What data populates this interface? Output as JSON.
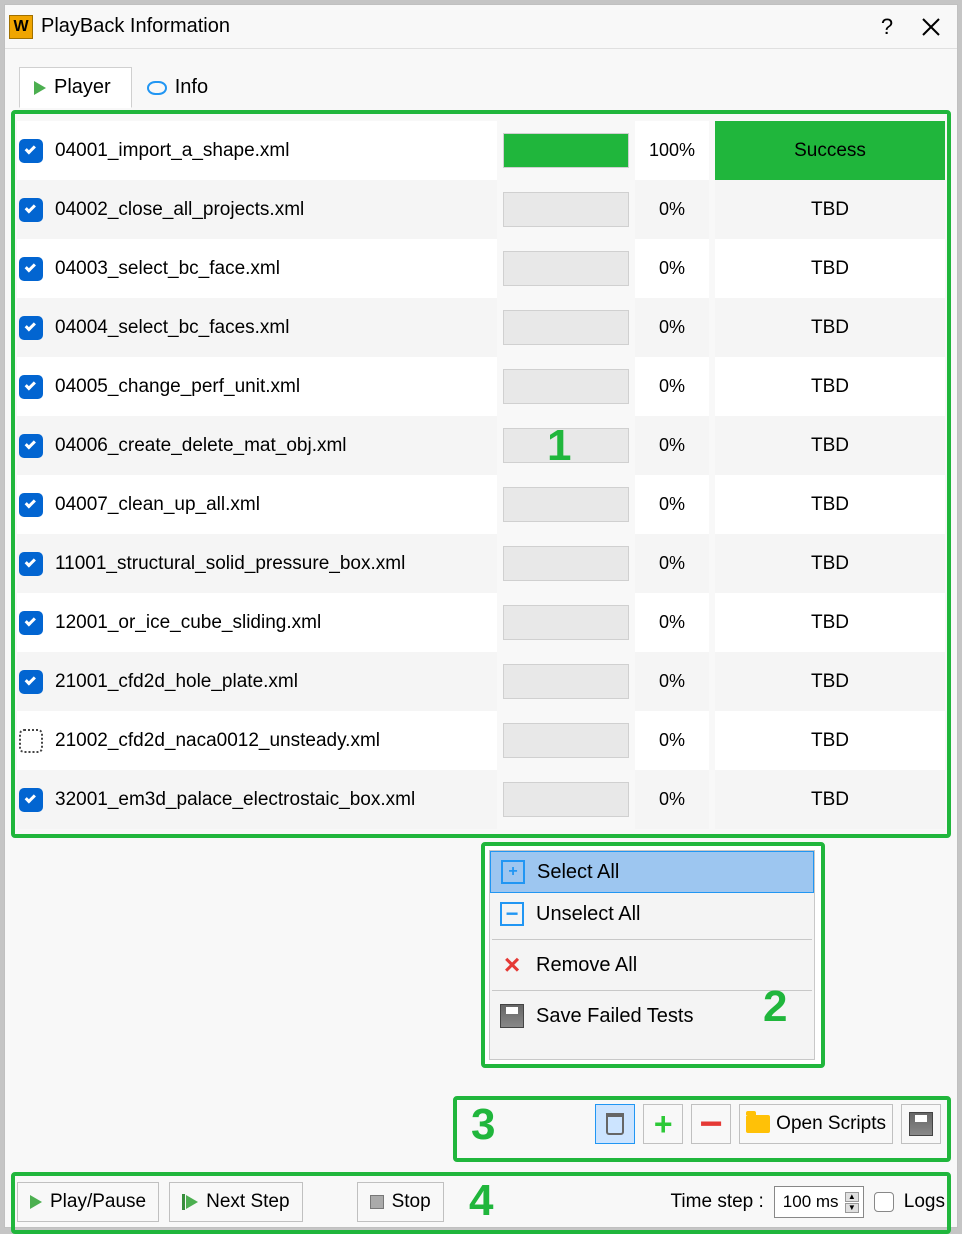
{
  "titlebar": {
    "title": "PlayBack Information"
  },
  "tabs": {
    "player": "Player",
    "info": "Info"
  },
  "tests": [
    {
      "checked": true,
      "name": "04001_import_a_shape.xml",
      "percent": "100%",
      "status": "Success",
      "success": true
    },
    {
      "checked": true,
      "name": "04002_close_all_projects.xml",
      "percent": "0%",
      "status": "TBD",
      "success": false
    },
    {
      "checked": true,
      "name": "04003_select_bc_face.xml",
      "percent": "0%",
      "status": "TBD",
      "success": false
    },
    {
      "checked": true,
      "name": "04004_select_bc_faces.xml",
      "percent": "0%",
      "status": "TBD",
      "success": false
    },
    {
      "checked": true,
      "name": "04005_change_perf_unit.xml",
      "percent": "0%",
      "status": "TBD",
      "success": false
    },
    {
      "checked": true,
      "name": "04006_create_delete_mat_obj.xml",
      "percent": "0%",
      "status": "TBD",
      "success": false
    },
    {
      "checked": true,
      "name": "04007_clean_up_all.xml",
      "percent": "0%",
      "status": "TBD",
      "success": false
    },
    {
      "checked": true,
      "name": "11001_structural_solid_pressure_box.xml",
      "percent": "0%",
      "status": "TBD",
      "success": false
    },
    {
      "checked": true,
      "name": "12001_or_ice_cube_sliding.xml",
      "percent": "0%",
      "status": "TBD",
      "success": false
    },
    {
      "checked": true,
      "name": "21001_cfd2d_hole_plate.xml",
      "percent": "0%",
      "status": "TBD",
      "success": false
    },
    {
      "checked": false,
      "name": "21002_cfd2d_naca0012_unsteady.xml",
      "percent": "0%",
      "status": "TBD",
      "success": false
    },
    {
      "checked": true,
      "name": "32001_em3d_palace_electrostaic_box.xml",
      "percent": "0%",
      "status": "TBD",
      "success": false
    }
  ],
  "context_menu": {
    "select_all": "Select All",
    "unselect_all": "Unselect All",
    "remove_all": "Remove All",
    "save_failed": "Save Failed Tests"
  },
  "toolbar3": {
    "open_scripts": "Open Scripts"
  },
  "toolbar4": {
    "play_pause": "Play/Pause",
    "next_step": "Next Step",
    "stop": "Stop",
    "time_step_label": "Time step :",
    "time_step_value": "100 ms",
    "logs": "Logs"
  },
  "annotations": {
    "n1": "1",
    "n2": "2",
    "n3": "3",
    "n4": "4"
  },
  "colors": {
    "success_bg": "#20b63c",
    "highlight_bg": "#20b63c"
  }
}
